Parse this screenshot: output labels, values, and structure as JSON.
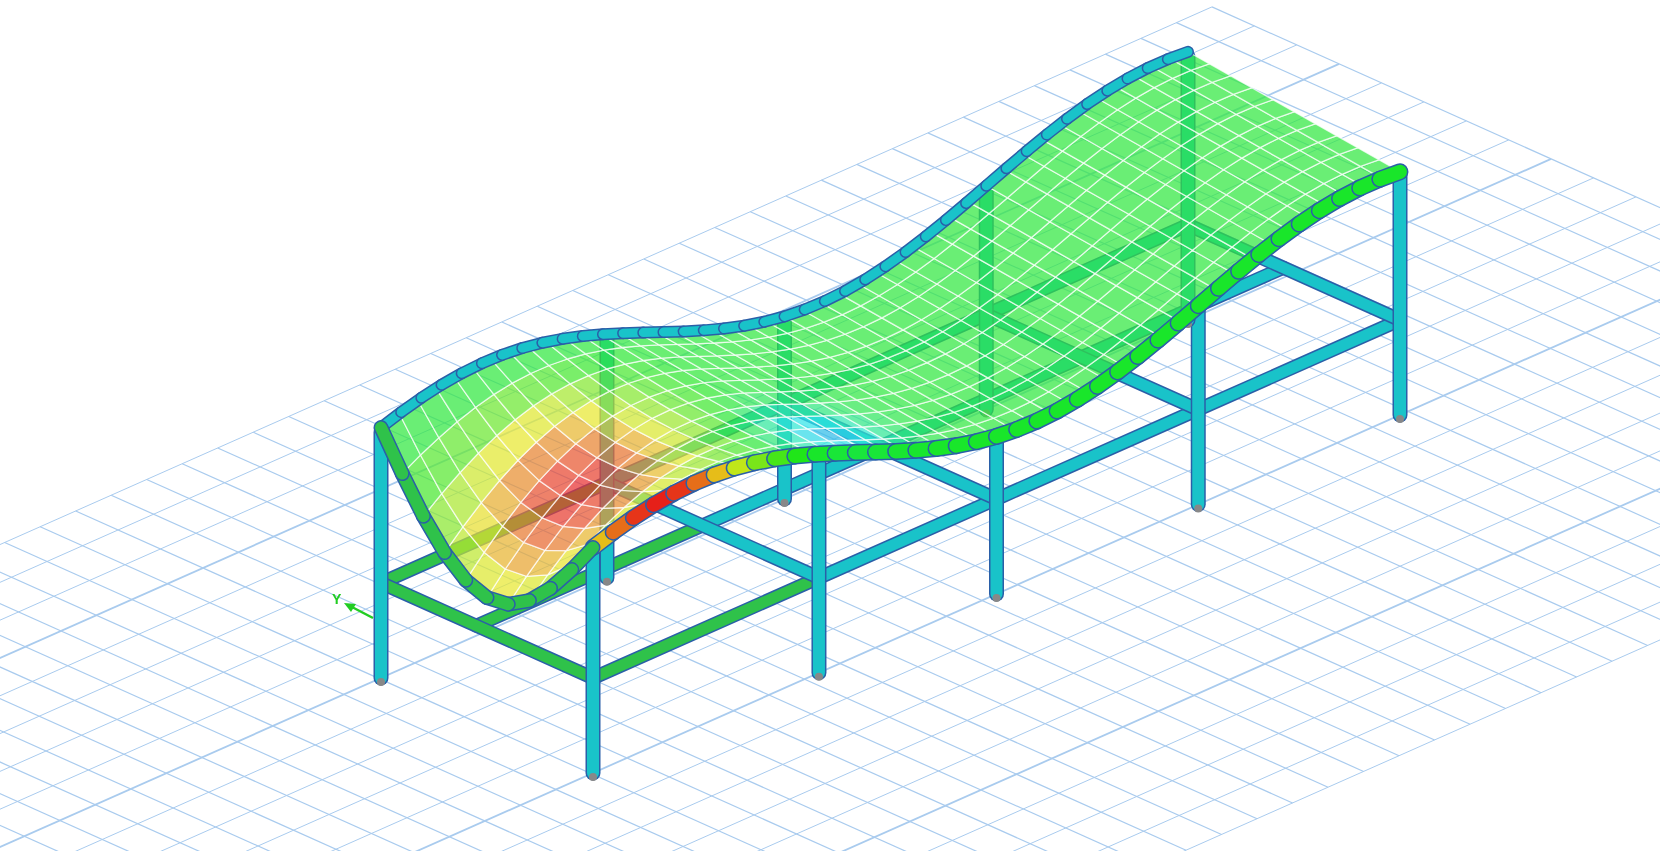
{
  "viewport": {
    "axis_triad": {
      "y_label": "Y"
    }
  }
}
